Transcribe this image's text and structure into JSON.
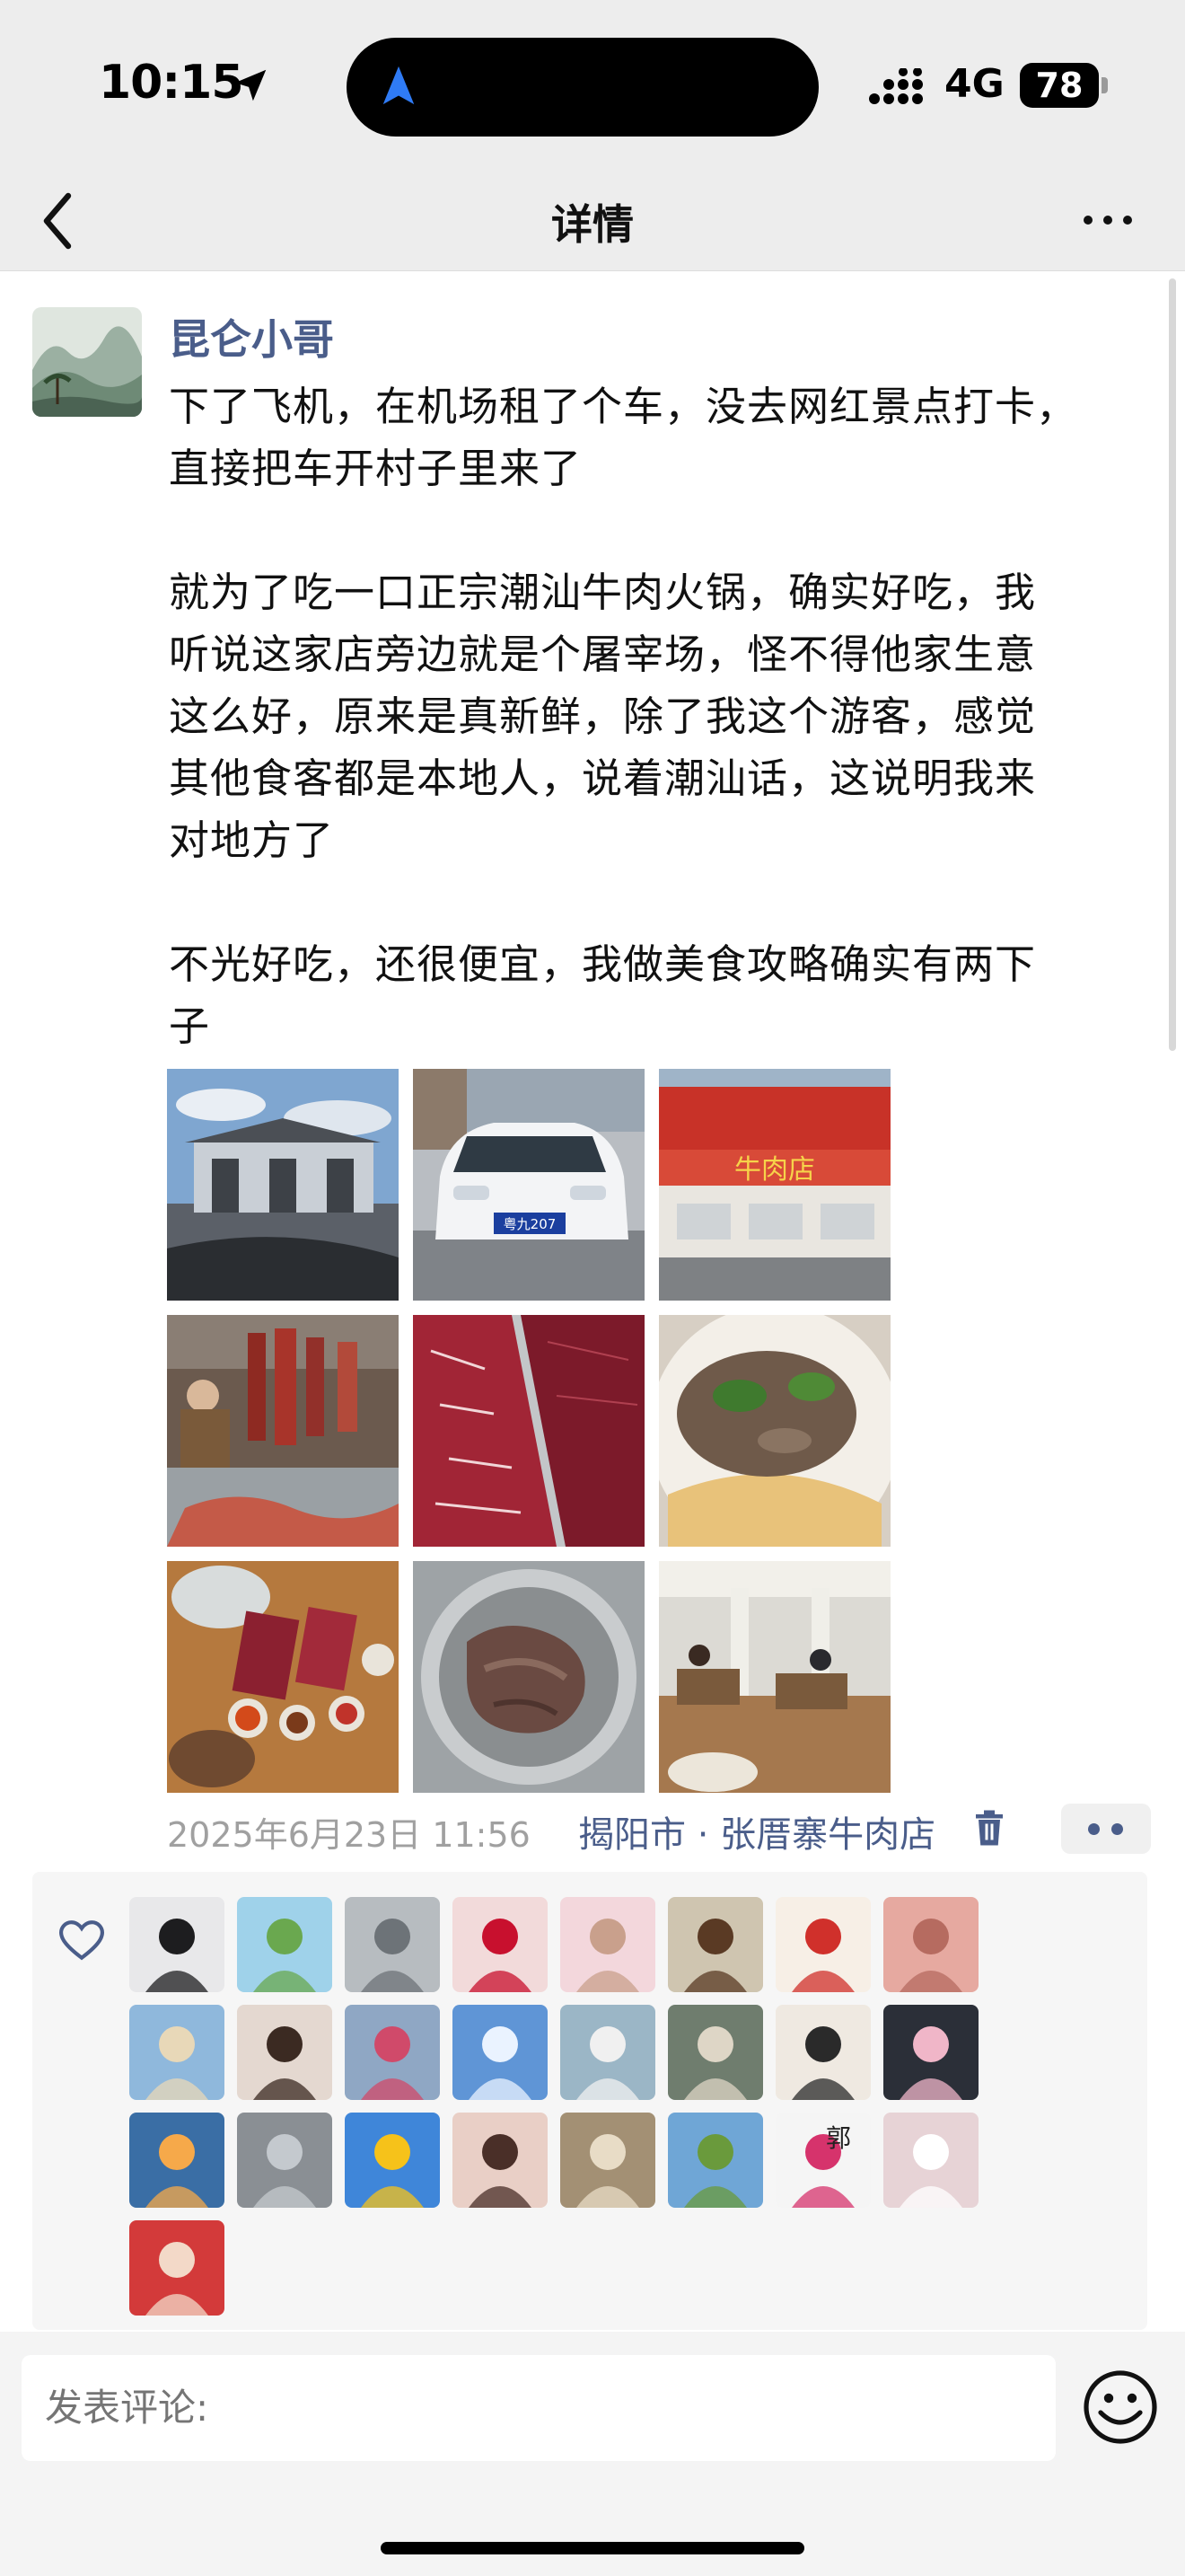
{
  "status_bar": {
    "time": "10:15",
    "network": "4G",
    "battery_level": "78"
  },
  "nav": {
    "title": "详情"
  },
  "post": {
    "author": "昆仑小哥",
    "text": "下了飞机，在机场租了个车，没去网红景点打卡，\n直接把车开村子里来了\n\n就为了吃一口正宗潮汕牛肉火锅，确实好吃，我\n听说这家店旁边就是个屠宰场，怪不得他家生意\n这么好，原来是真新鲜，除了我这个游客，感觉\n其他食客都是本地人，说着潮汕话，这说明我来\n对地方了\n\n不光好吃，还很便宜，我做美食攻略确实有两下\n子",
    "photos": [
      {
        "name": "photo-airport-gate",
        "sign_text": ""
      },
      {
        "name": "photo-rental-car",
        "plate": "粤九207"
      },
      {
        "name": "photo-shop-front",
        "sign_text": "牛肉店"
      },
      {
        "name": "photo-butcher"
      },
      {
        "name": "photo-raw-beef-plates"
      },
      {
        "name": "photo-beef-noodles"
      },
      {
        "name": "photo-hotpot-table"
      },
      {
        "name": "photo-beef-in-strainer"
      },
      {
        "name": "photo-restaurant-interior"
      }
    ],
    "timestamp": "2025年6月23日 11:56",
    "location": "揭阳市 · 张厝寨牛肉店"
  },
  "likes": {
    "avatars": [
      {
        "name": "anime-boy",
        "bg": "#e8e8ea",
        "fg": "#1d1d1f"
      },
      {
        "name": "cartoon-meadow",
        "bg": "#9fd2ea",
        "fg": "#6aa84f"
      },
      {
        "name": "cloudy-sky",
        "bg": "#b7bcc0",
        "fg": "#6d7378"
      },
      {
        "name": "couple-red",
        "bg": "#f2dada",
        "fg": "#c8102e"
      },
      {
        "name": "pink-portrait",
        "bg": "#f3d7dc",
        "fg": "#c9a08c"
      },
      {
        "name": "woman-garden",
        "bg": "#cfc5b0",
        "fg": "#5a3a24"
      },
      {
        "name": "watermelon-girl",
        "bg": "#f7efe6",
        "fg": "#d0302b"
      },
      {
        "name": "pink-abstract",
        "bg": "#e6a9a0",
        "fg": "#b66b60"
      },
      {
        "name": "beach-walk",
        "bg": "#8fb8dc",
        "fg": "#e8d8b8"
      },
      {
        "name": "girl-bedroom",
        "bg": "#e4d8d0",
        "fg": "#3b2a22"
      },
      {
        "name": "flowers-book",
        "bg": "#8fa7c4",
        "fg": "#d04a6a"
      },
      {
        "name": "blue-sky-plane",
        "bg": "#5f95d6",
        "fg": "#eaf3ff"
      },
      {
        "name": "water-town",
        "bg": "#9bb6c6",
        "fg": "#f0f0f0"
      },
      {
        "name": "lake-dock",
        "bg": "#6f7d6e",
        "fg": "#ded6c6"
      },
      {
        "name": "girl-sketch",
        "bg": "#efe9e1",
        "fg": "#2a2a2a"
      },
      {
        "name": "cartoon-bear",
        "bg": "#2b2f38",
        "fg": "#f0b6c8"
      },
      {
        "name": "sunset-sea",
        "bg": "#3a6ea5",
        "fg": "#f6a94a"
      },
      {
        "name": "street-building",
        "bg": "#8a8f94",
        "fg": "#c4c9ce"
      },
      {
        "name": "sunflower",
        "bg": "#3f86d9",
        "fg": "#f6c21a"
      },
      {
        "name": "portrait-woman",
        "bg": "#e9cfc6",
        "fg": "#4a2f28"
      },
      {
        "name": "couple-vintage",
        "bg": "#a39074",
        "fg": "#e8dcc6"
      },
      {
        "name": "painted-house",
        "bg": "#6fa6d6",
        "fg": "#6a9a3c"
      },
      {
        "name": "lotus-character",
        "bg": "#f5f5f5",
        "fg": "#d6336c",
        "glyph": "郭"
      },
      {
        "name": "girl-field",
        "bg": "#e7d3d6",
        "fg": "#ffffff"
      },
      {
        "name": "woman-red",
        "bg": "#d33a3a",
        "fg": "#f3d9c8"
      }
    ]
  },
  "comment": {
    "placeholder": "发表评论:"
  },
  "colors": {
    "link": "#4a5d8a",
    "meta": "#a0a0a0",
    "background": "#ededed"
  },
  "icons": [
    "location-arrow-icon",
    "navigation-icon",
    "signal-icon",
    "battery-icon",
    "back-icon",
    "more-icon",
    "trash-icon",
    "heart-icon",
    "emoji-icon"
  ]
}
